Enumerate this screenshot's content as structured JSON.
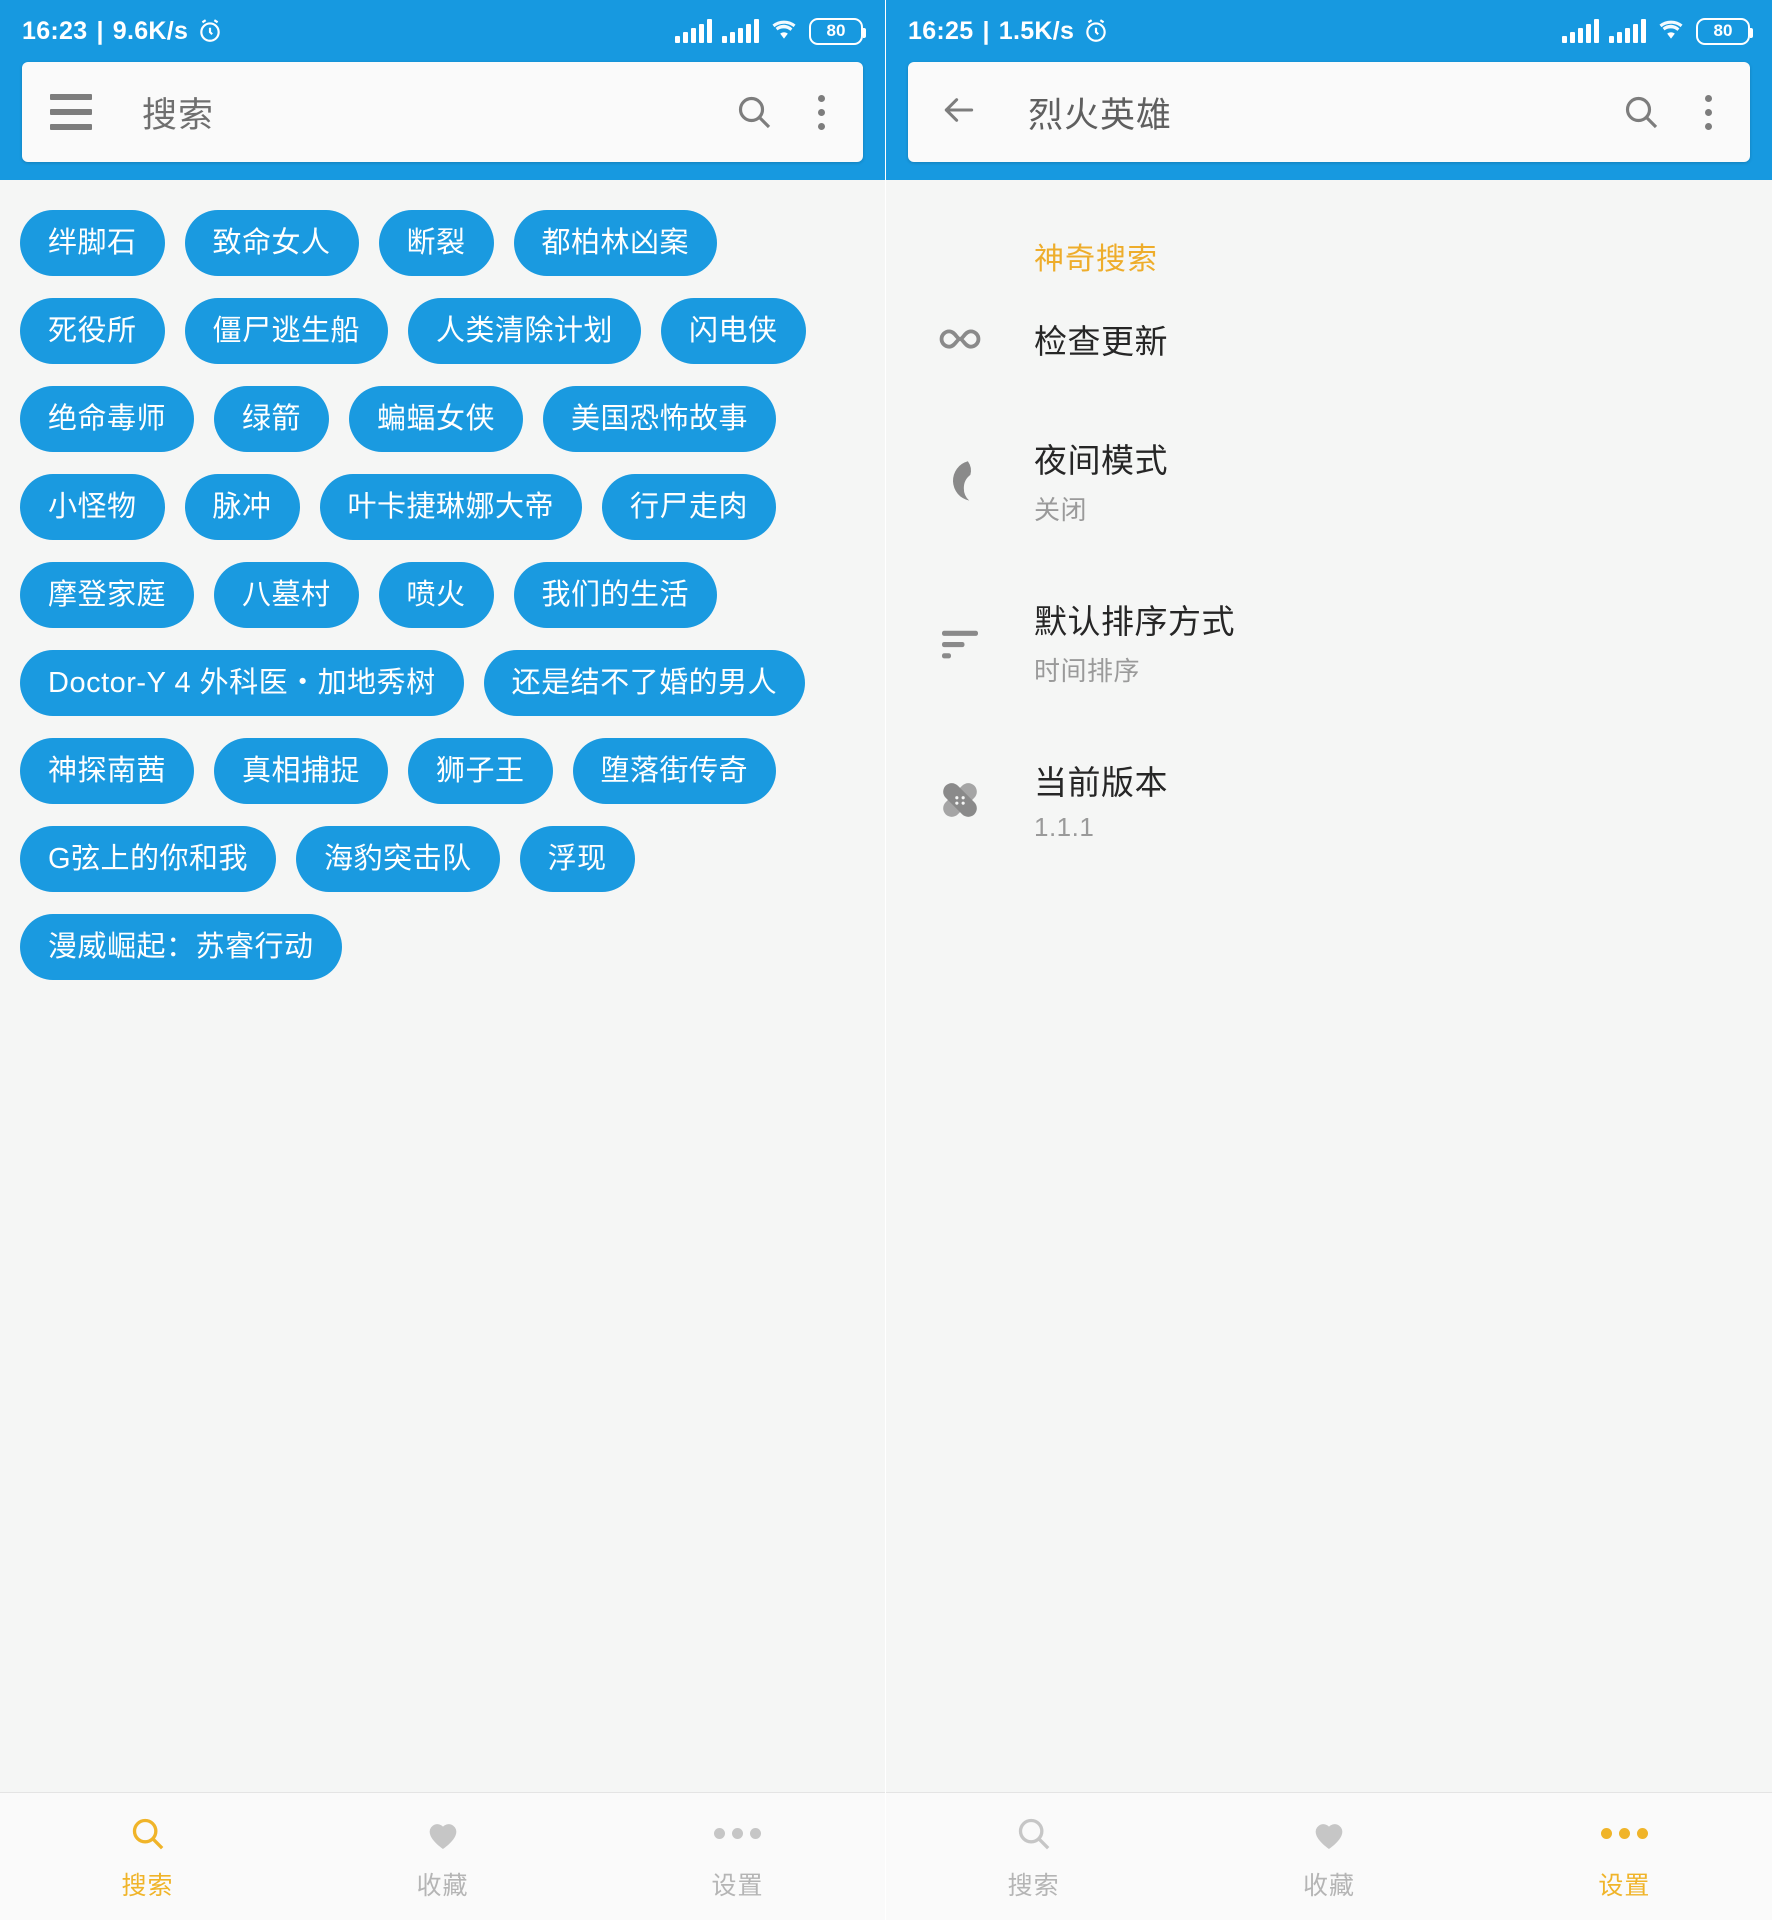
{
  "screens": [
    {
      "id": "search-screen",
      "statusbar": {
        "time": "16:23",
        "separator": "|",
        "network_speed": "9.6K/s",
        "alarm_icon": "alarm-clock-icon",
        "battery": "80"
      },
      "appbar": {
        "nav_icon": "hamburger-menu-icon",
        "title": "搜索",
        "search_icon": "search-icon",
        "overflow_icon": "more-vertical-icon"
      },
      "chips": [
        "绊脚石",
        "致命女人",
        "断裂",
        "都柏林凶案",
        "死役所",
        "僵尸逃生船",
        "人类清除计划",
        "闪电侠",
        "绝命毒师",
        "绿箭",
        "蝙蝠女侠",
        "美国恐怖故事",
        "小怪物",
        "脉冲",
        "叶卡捷琳娜大帝",
        "行尸走肉",
        "摩登家庭",
        "八墓村",
        "喷火",
        "我们的生活",
        "Doctor-Y 4 外科医・加地秀树",
        "还是结不了婚的男人",
        "神探南茜",
        "真相捕捉",
        "狮子王",
        "堕落街传奇",
        "G弦上的你和我",
        "海豹突击队",
        "浮现",
        "漫威崛起：苏睿行动"
      ],
      "bottomnav": [
        {
          "label": "搜索",
          "icon": "search-icon",
          "active": true
        },
        {
          "label": "收藏",
          "icon": "heart-icon",
          "active": false
        },
        {
          "label": "设置",
          "icon": "more-horizontal-icon",
          "active": false
        }
      ]
    },
    {
      "id": "settings-screen",
      "statusbar": {
        "time": "16:25",
        "separator": "|",
        "network_speed": "1.5K/s",
        "alarm_icon": "alarm-clock-icon",
        "battery": "80"
      },
      "appbar": {
        "nav_icon": "back-arrow-icon",
        "title": "烈火英雄",
        "search_icon": "search-icon",
        "overflow_icon": "more-vertical-icon"
      },
      "section_title": "神奇搜索",
      "settings": [
        {
          "icon": "infinity-icon",
          "title": "检查更新",
          "sub": ""
        },
        {
          "icon": "moon-icon",
          "title": "夜间模式",
          "sub": "关闭"
        },
        {
          "icon": "sort-icon",
          "title": "默认排序方式",
          "sub": "时间排序"
        },
        {
          "icon": "bandage-icon",
          "title": "当前版本",
          "sub": "1.1.1"
        }
      ],
      "bottomnav": [
        {
          "label": "搜索",
          "icon": "search-icon",
          "active": false
        },
        {
          "label": "收藏",
          "icon": "heart-icon",
          "active": false
        },
        {
          "label": "设置",
          "icon": "more-horizontal-icon",
          "active": true
        }
      ]
    }
  ],
  "colors": {
    "primary_blue": "#1799e0",
    "chip_blue": "#1a9ae0",
    "accent_orange": "#eead2b",
    "nav_active": "#f0b429",
    "background": "#f5f6f5"
  }
}
